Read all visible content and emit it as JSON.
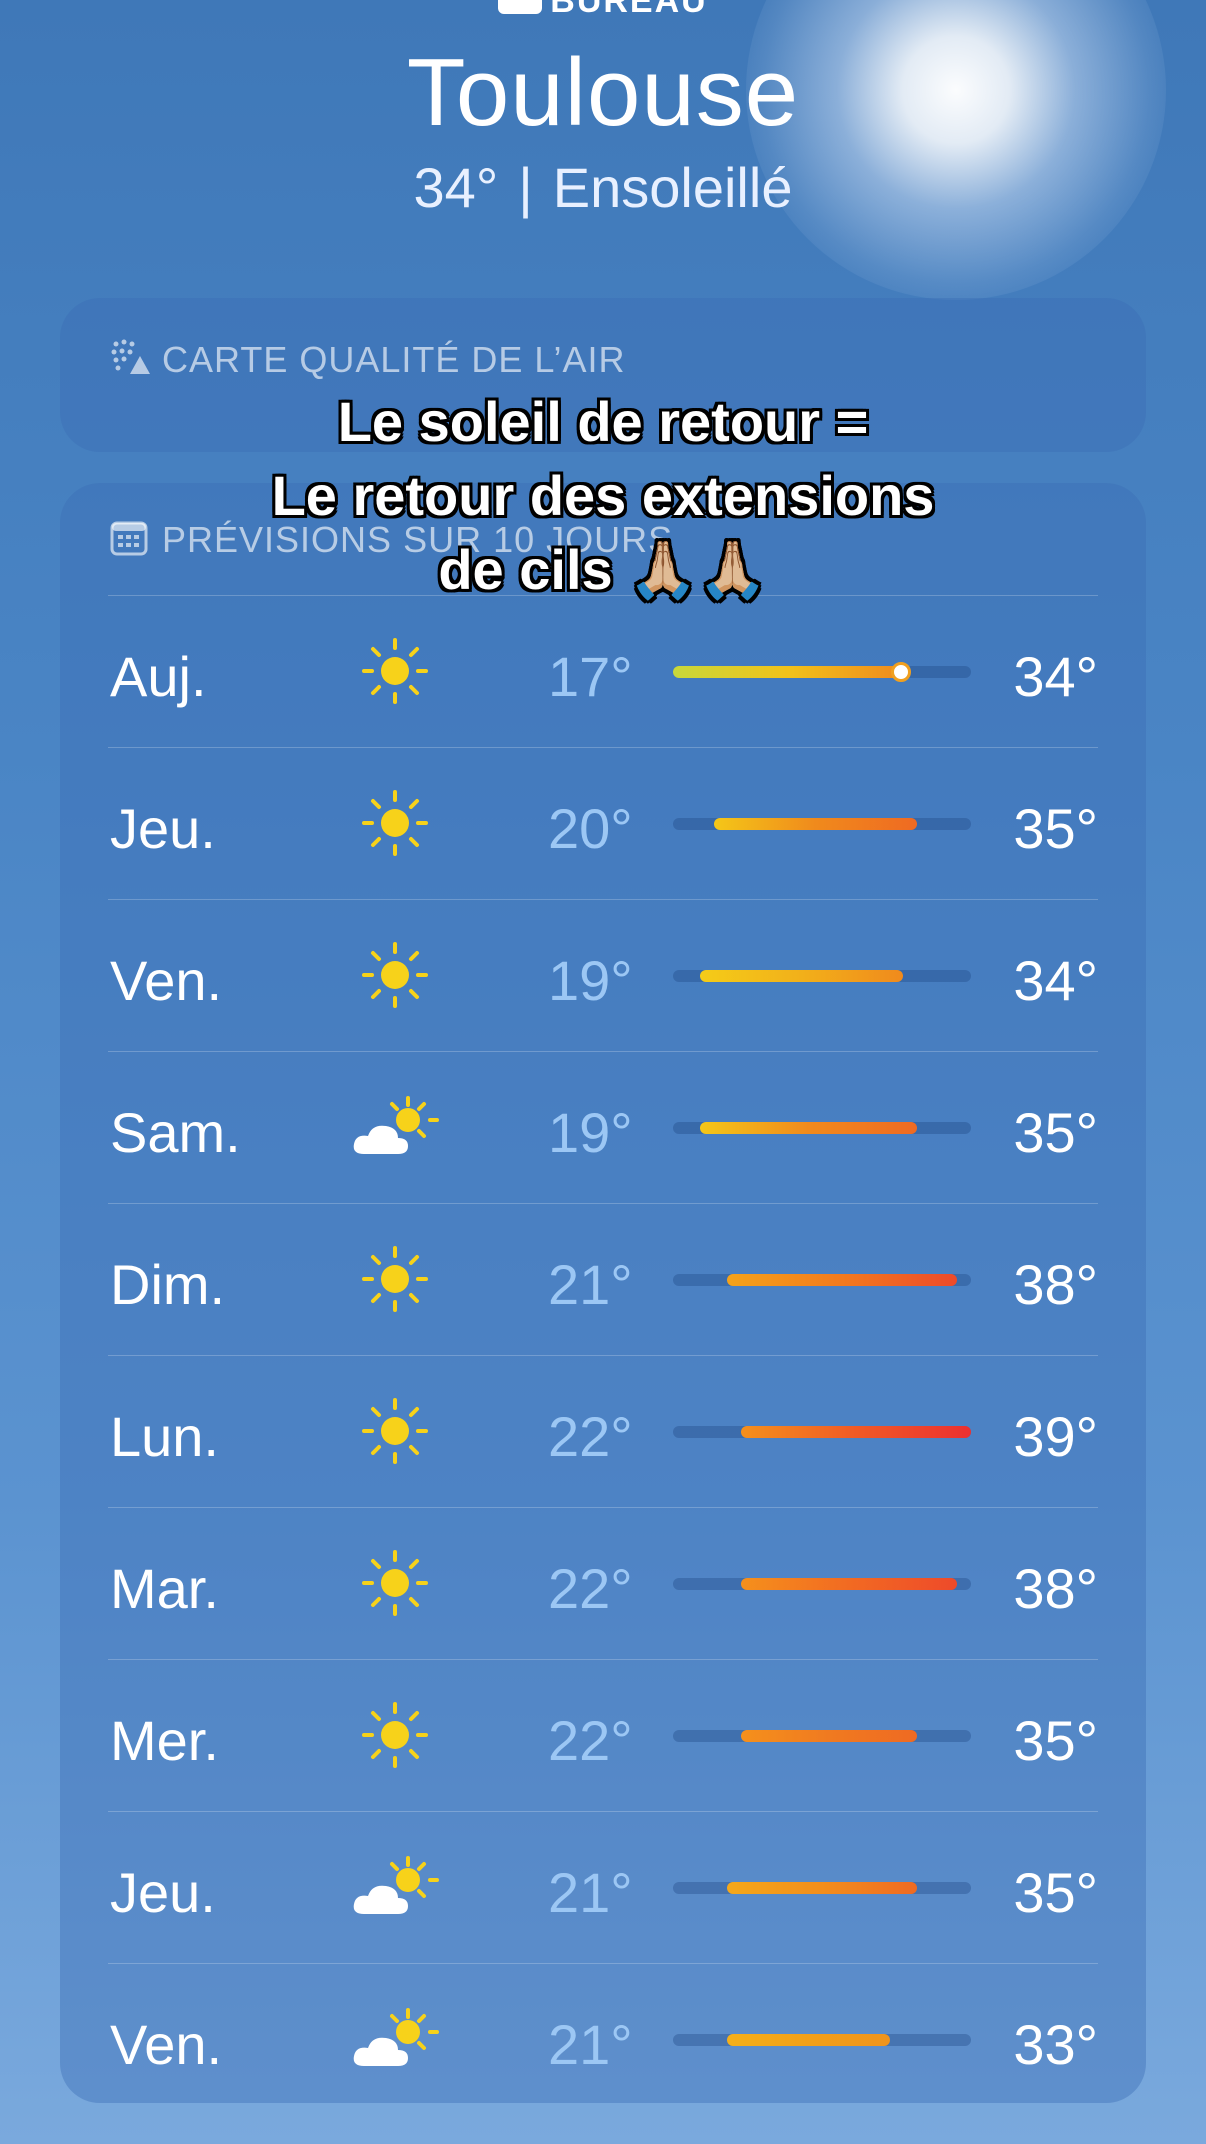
{
  "header": {
    "location_label": "BUREAU",
    "city": "Toulouse",
    "current_temp": "34°",
    "separator": "|",
    "condition": "Ensoleillé"
  },
  "air_quality_card": {
    "title": "CARTE QUALITÉ DE L’AIR",
    "icon": "air-quality-icon"
  },
  "forecast_card": {
    "title": "PRÉVISIONS SUR 10 JOURS",
    "icon": "calendar-icon",
    "scale": {
      "min": 17,
      "max": 39
    },
    "days": [
      {
        "day": "Auj.",
        "icon": "sun-icon",
        "low": "17°",
        "high": "34°",
        "low_val": 17,
        "high_val": 34,
        "current_val": 34,
        "current": true,
        "colors": [
          "#c8d83a",
          "#f2c21a",
          "#f08a1c"
        ]
      },
      {
        "day": "Jeu.",
        "icon": "sun-icon",
        "low": "20°",
        "high": "35°",
        "low_val": 20,
        "high_val": 35,
        "colors": [
          "#f4c718",
          "#f08a1c",
          "#ef6a22"
        ]
      },
      {
        "day": "Ven.",
        "icon": "sun-icon",
        "low": "19°",
        "high": "34°",
        "low_val": 19,
        "high_val": 34,
        "colors": [
          "#f4cc18",
          "#f2b01a",
          "#f08a1c"
        ]
      },
      {
        "day": "Sam.",
        "icon": "cloud-sun-icon",
        "low": "19°",
        "high": "35°",
        "low_val": 19,
        "high_val": 35,
        "colors": [
          "#f4c718",
          "#f08a1c",
          "#ef6a22"
        ]
      },
      {
        "day": "Dim.",
        "icon": "sun-icon",
        "low": "21°",
        "high": "38°",
        "low_val": 21,
        "high_val": 38,
        "colors": [
          "#f5a31a",
          "#f27a1e",
          "#ee4a2a"
        ]
      },
      {
        "day": "Lun.",
        "icon": "sun-icon",
        "low": "22°",
        "high": "39°",
        "low_val": 22,
        "high_val": 39,
        "colors": [
          "#f5901c",
          "#f15a26",
          "#ec3030"
        ]
      },
      {
        "day": "Mar.",
        "icon": "sun-icon",
        "low": "22°",
        "high": "38°",
        "low_val": 22,
        "high_val": 38,
        "colors": [
          "#f5901c",
          "#f26a22",
          "#ee4a2a"
        ]
      },
      {
        "day": "Mer.",
        "icon": "sun-icon",
        "low": "22°",
        "high": "35°",
        "low_val": 22,
        "high_val": 35,
        "colors": [
          "#f5901c",
          "#f07a20",
          "#ef6a22"
        ]
      },
      {
        "day": "Jeu.",
        "icon": "cloud-sun-icon",
        "low": "21°",
        "high": "35°",
        "low_val": 21,
        "high_val": 35,
        "colors": [
          "#f5a81a",
          "#f28e1c",
          "#ef6a22"
        ]
      },
      {
        "day": "Ven.",
        "icon": "cloud-sun-icon",
        "low": "21°",
        "high": "33°",
        "low_val": 21,
        "high_val": 33,
        "colors": [
          "#f5b01a",
          "#f2a01a",
          "#f0941c"
        ]
      }
    ]
  },
  "overlay_caption": {
    "line1": "Le soleil de retour =",
    "line2": "Le retour des extensions",
    "line3": "de cils 🙏🏼🙏🏼"
  }
}
